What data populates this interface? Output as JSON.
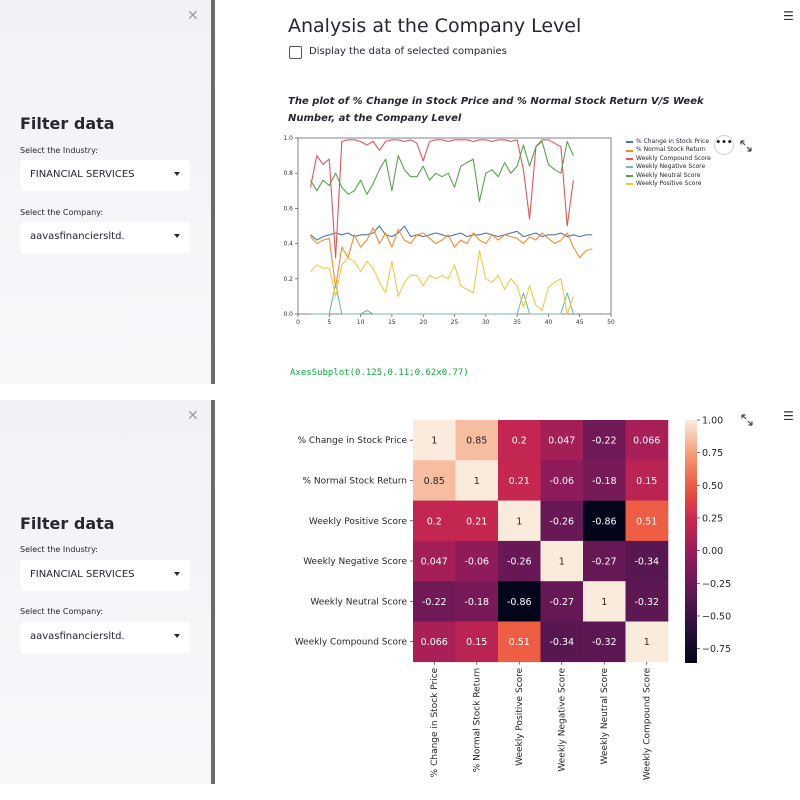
{
  "sidebar": {
    "title": "Filter data",
    "industry_label": "Select the Industry:",
    "industry_value": "FINANCIAL SERVICES",
    "company_label": "Select the Company:",
    "company_value": "aavasfinanciersltd."
  },
  "main": {
    "title": "Analysis at the Company Level",
    "checkbox_label": "Display the data of selected companies",
    "plot_title": "The plot of % Change in Stock Price and % Normal Stock Return V/S Week Number, at the Company Level",
    "axes_repr": "AxesSubplot(0.125,0.11;0.62x0.77)"
  },
  "chart_data": [
    {
      "type": "line",
      "title": "",
      "xlabel": "",
      "ylabel": "",
      "xlim": [
        0,
        50
      ],
      "ylim": [
        0,
        1.0
      ],
      "xticks": [
        "0",
        "5",
        "10",
        "15",
        "20",
        "25",
        "30",
        "35",
        "40",
        "45",
        "50"
      ],
      "yticks": [
        "0.0",
        "0.2",
        "0.4",
        "0.6",
        "0.8",
        "1.0"
      ],
      "legend_placement": "upper-right outside",
      "series": [
        {
          "name": "% Change in Stock Price",
          "color": "#4e79a7",
          "x": [
            2,
            3,
            4,
            5,
            6,
            7,
            8,
            9,
            10,
            11,
            12,
            13,
            14,
            15,
            16,
            17,
            18,
            19,
            20,
            21,
            22,
            23,
            24,
            25,
            26,
            27,
            28,
            29,
            30,
            31,
            32,
            33,
            34,
            35,
            36,
            37,
            38,
            39,
            40,
            41,
            42,
            43,
            44,
            45,
            46,
            47
          ],
          "y": [
            0.45,
            0.42,
            0.44,
            0.45,
            0.46,
            0.45,
            0.46,
            0.44,
            0.45,
            0.45,
            0.46,
            0.5,
            0.45,
            0.44,
            0.46,
            0.5,
            0.44,
            0.45,
            0.44,
            0.45,
            0.46,
            0.45,
            0.44,
            0.45,
            0.46,
            0.44,
            0.45,
            0.45,
            0.46,
            0.45,
            0.44,
            0.45,
            0.46,
            0.47,
            0.44,
            0.45,
            0.46,
            0.44,
            0.45,
            0.45,
            0.46,
            0.44,
            0.45,
            0.44,
            0.45,
            0.45
          ]
        },
        {
          "name": "% Normal Stock Return",
          "color": "#f28e2b",
          "x": [
            2,
            3,
            4,
            5,
            6,
            7,
            8,
            9,
            10,
            11,
            12,
            13,
            14,
            15,
            16,
            17,
            18,
            19,
            20,
            21,
            22,
            23,
            24,
            25,
            26,
            27,
            28,
            29,
            30,
            31,
            32,
            33,
            34,
            35,
            36,
            37,
            38,
            39,
            40,
            41,
            42,
            43,
            44,
            45,
            46,
            47
          ],
          "y": [
            0.44,
            0.4,
            0.42,
            0.43,
            0.15,
            0.38,
            0.32,
            0.45,
            0.38,
            0.42,
            0.49,
            0.4,
            0.46,
            0.38,
            0.48,
            0.42,
            0.4,
            0.45,
            0.46,
            0.43,
            0.4,
            0.42,
            0.45,
            0.38,
            0.42,
            0.4,
            0.46,
            0.42,
            0.4,
            0.45,
            0.42,
            0.45,
            0.44,
            0.43,
            0.4,
            0.44,
            0.42,
            0.46,
            0.43,
            0.4,
            0.42,
            0.46,
            0.38,
            0.32,
            0.36,
            0.37
          ]
        },
        {
          "name": "Weekly Compound Score",
          "color": "#e15759",
          "x": [
            2,
            3,
            4,
            5,
            6,
            7,
            8,
            9,
            10,
            11,
            12,
            13,
            14,
            15,
            16,
            17,
            18,
            19,
            20,
            21,
            22,
            23,
            24,
            25,
            26,
            27,
            28,
            29,
            30,
            31,
            32,
            33,
            34,
            35,
            36,
            37,
            38,
            39,
            40,
            41,
            42,
            43,
            44
          ],
          "y": [
            0.72,
            0.9,
            0.85,
            0.88,
            0.32,
            0.98,
            0.99,
            0.99,
            0.98,
            0.96,
            0.98,
            0.93,
            0.98,
            0.99,
            0.99,
            0.98,
            0.99,
            0.97,
            0.87,
            0.98,
            0.99,
            0.99,
            0.98,
            0.99,
            0.99,
            0.99,
            0.98,
            0.99,
            0.99,
            0.98,
            0.99,
            0.99,
            0.98,
            0.99,
            0.82,
            0.54,
            0.95,
            0.99,
            0.99,
            0.97,
            0.95,
            0.5,
            0.76
          ]
        },
        {
          "name": "Weekly Negative Score",
          "color": "#76b7b2",
          "x": [
            2,
            3,
            4,
            5,
            6,
            7,
            8,
            9,
            10,
            11,
            12,
            13,
            14,
            15,
            16,
            17,
            18,
            19,
            20,
            21,
            22,
            23,
            24,
            25,
            26,
            27,
            28,
            29,
            30,
            31,
            32,
            33,
            34,
            35,
            36,
            37,
            38,
            39,
            40,
            41,
            42,
            43,
            44
          ],
          "y": [
            0.0,
            0.0,
            0.0,
            0.0,
            0.17,
            0.0,
            0.0,
            0.0,
            0.0,
            0.02,
            0.0,
            0.0,
            0.0,
            0.0,
            0.0,
            0.0,
            0.0,
            0.0,
            0.0,
            0.0,
            0.0,
            0.0,
            0.0,
            0.0,
            0.0,
            0.0,
            0.0,
            0.0,
            0.0,
            0.0,
            0.0,
            0.0,
            0.0,
            0.0,
            0.12,
            0.0,
            0.0,
            0.0,
            0.0,
            0.0,
            0.0,
            0.12,
            0.0
          ]
        },
        {
          "name": "Weekly Neutral Score",
          "color": "#59a14f",
          "x": [
            2,
            3,
            4,
            5,
            6,
            7,
            8,
            9,
            10,
            11,
            12,
            13,
            14,
            15,
            16,
            17,
            18,
            19,
            20,
            21,
            22,
            23,
            24,
            25,
            26,
            27,
            28,
            29,
            30,
            31,
            32,
            33,
            34,
            35,
            36,
            37,
            38,
            39,
            40,
            41,
            42,
            43,
            44
          ],
          "y": [
            0.76,
            0.7,
            0.76,
            0.73,
            0.8,
            0.72,
            0.68,
            0.7,
            0.76,
            0.68,
            0.74,
            0.82,
            0.88,
            0.7,
            0.9,
            0.82,
            0.78,
            0.78,
            0.84,
            0.76,
            0.8,
            0.78,
            0.8,
            0.72,
            0.84,
            0.86,
            0.88,
            0.64,
            0.8,
            0.82,
            0.78,
            0.86,
            0.8,
            0.84,
            0.96,
            0.84,
            0.95,
            0.98,
            0.85,
            0.82,
            0.8,
            0.98,
            0.9
          ]
        },
        {
          "name": "Weekly Positive Score",
          "color": "#edc948",
          "x": [
            2,
            3,
            4,
            5,
            6,
            7,
            8,
            9,
            10,
            11,
            12,
            13,
            14,
            15,
            16,
            17,
            18,
            19,
            20,
            21,
            22,
            23,
            24,
            25,
            26,
            27,
            28,
            29,
            30,
            31,
            32,
            33,
            34,
            35,
            36,
            37,
            38,
            39,
            40,
            41,
            42,
            43,
            44
          ],
          "y": [
            0.24,
            0.28,
            0.26,
            0.26,
            0.1,
            0.28,
            0.32,
            0.3,
            0.24,
            0.3,
            0.26,
            0.18,
            0.12,
            0.3,
            0.1,
            0.18,
            0.22,
            0.22,
            0.16,
            0.22,
            0.2,
            0.22,
            0.2,
            0.28,
            0.16,
            0.14,
            0.12,
            0.36,
            0.2,
            0.18,
            0.22,
            0.14,
            0.2,
            0.16,
            0.04,
            0.16,
            0.05,
            0.02,
            0.15,
            0.18,
            0.2,
            0.0,
            0.1
          ]
        }
      ]
    },
    {
      "type": "heatmap",
      "title": "",
      "rows": [
        "% Change in Stock Price",
        "% Normal Stock Return",
        "Weekly Positive Score",
        "Weekly Negative Score",
        "Weekly Neutral Score",
        "Weekly Compound Score"
      ],
      "columns": [
        "% Change in Stock Price",
        "% Normal Stock Return",
        "Weekly Positive Score",
        "Weekly Negative Score",
        "Weekly Neutral Score",
        "Weekly Compound Score"
      ],
      "values": [
        [
          1,
          0.85,
          0.2,
          0.047,
          -0.22,
          0.066
        ],
        [
          0.85,
          1,
          0.21,
          -0.06,
          -0.18,
          0.15
        ],
        [
          0.2,
          0.21,
          1,
          -0.26,
          -0.86,
          0.51
        ],
        [
          0.047,
          -0.06,
          -0.26,
          1,
          -0.27,
          -0.34
        ],
        [
          -0.22,
          -0.18,
          -0.86,
          -0.27,
          1,
          -0.32
        ],
        [
          0.066,
          0.15,
          0.51,
          -0.34,
          -0.32,
          1
        ]
      ],
      "labels": [
        [
          "1",
          "0.85",
          "0.2",
          "0.047",
          "-0.22",
          "0.066"
        ],
        [
          "0.85",
          "1",
          "0.21",
          "-0.06",
          "-0.18",
          "0.15"
        ],
        [
          "0.2",
          "0.21",
          "1",
          "-0.26",
          "-0.86",
          "0.51"
        ],
        [
          "0.047",
          "-0.06",
          "-0.26",
          "1",
          "-0.27",
          "-0.34"
        ],
        [
          "-0.22",
          "-0.18",
          "-0.86",
          "-0.27",
          "1",
          "-0.32"
        ],
        [
          "0.066",
          "0.15",
          "0.51",
          "-0.34",
          "-0.32",
          "1"
        ]
      ],
      "colorbar_ticks": [
        "1.00",
        "0.75",
        "0.50",
        "0.25",
        "0.00",
        "−0.25",
        "−0.50",
        "−0.75"
      ],
      "colorbar_values": [
        1.0,
        0.75,
        0.5,
        0.25,
        0.0,
        -0.25,
        -0.5,
        -0.75
      ],
      "vmin": -0.86,
      "vmax": 1.0
    }
  ]
}
